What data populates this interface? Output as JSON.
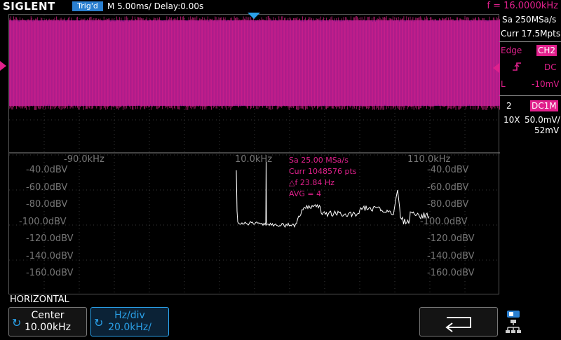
{
  "topbar": {
    "logo": "SIGLENT",
    "trigger_status": "Trig'd",
    "timebase": "M 5.00ms/ Delay:0.00s",
    "frequency": "f = 16.0000kHz"
  },
  "right_panel": {
    "sample_rate": "Sa 250MSa/s",
    "memory": "Curr 17.5Mpts",
    "trigger_type": "Edge",
    "trigger_source": "CH2",
    "coupling": "DC",
    "level_label": "L",
    "level": "-10mV",
    "channel_number": "2",
    "channel_coupling": "DC1M",
    "probe": "10X",
    "volts_div": "50.0mV/",
    "offset": "52mV"
  },
  "fft": {
    "x_ticks": [
      "-90.0kHz",
      "10.0kHz",
      "110.0kHz"
    ],
    "y_ticks": [
      "-40.0dBV",
      "-60.0dBV",
      "-80.0dBV",
      "-100.0dBV",
      "-120.0dBV",
      "-140.0dBV",
      "-160.0dBV"
    ],
    "info": [
      "Sa 25.00 MSa/s",
      "Curr 1048576 pts",
      "△f 23.84 Hz",
      "AVG = 4"
    ]
  },
  "bottom_menu": {
    "title": "HORIZONTAL",
    "center_label": "Center",
    "center_value": "10.00kHz",
    "hzdiv_label": "Hz/div",
    "hzdiv_value": "20.0kHz/"
  },
  "colors": {
    "ch2": "#e0208c",
    "accent": "#2aa0e8",
    "spectrum": "#ffffff"
  },
  "icons": {
    "back": "return-arrow-icon",
    "network": "lan-icon"
  }
}
